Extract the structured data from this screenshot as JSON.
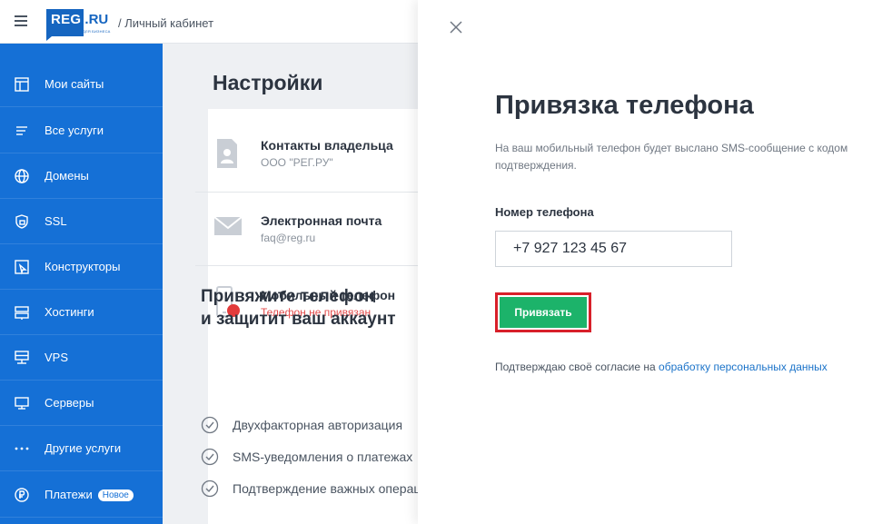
{
  "header": {
    "logo_main": "REG",
    "logo_ru": ".RU",
    "logo_sub": "ДЛЯ БИЗНЕСА",
    "breadcrumb": "/ Личный кабинет"
  },
  "sidebar": {
    "items": [
      {
        "label": "Мои сайты",
        "icon": "sites-icon"
      },
      {
        "label": "Все услуги",
        "icon": "list-icon"
      },
      {
        "label": "Домены",
        "icon": "globe-icon"
      },
      {
        "label": "SSL",
        "icon": "ssl-lock-icon"
      },
      {
        "label": "Конструкторы",
        "icon": "builder-icon"
      },
      {
        "label": "Хостинги",
        "icon": "hosting-icon"
      },
      {
        "label": "VPS",
        "icon": "vps-icon"
      },
      {
        "label": "Серверы",
        "icon": "server-icon"
      },
      {
        "label": "Другие услуги",
        "icon": "more-dots-icon"
      },
      {
        "label": "Платежи",
        "icon": "ruble-icon",
        "badge": "Новое"
      }
    ]
  },
  "main": {
    "title": "Настройки",
    "rows": [
      {
        "title": "Контакты владельца",
        "sub": "ООО \"РЕГ.РУ\"",
        "icon": "contact-card-icon"
      },
      {
        "title": "Электронная почта",
        "sub": "faq@reg.ru",
        "icon": "envelope-icon"
      },
      {
        "title": "Мобильный телефон",
        "sub": "Телефон не привязан",
        "icon": "phone-icon"
      }
    ],
    "promo_line1": "Привяжите телефон",
    "promo_line2": "и защитит ваш аккаунт",
    "checks": [
      "Двухфакторная авторизация",
      "SMS-уведомления о платежах",
      "Подтверждение важных операций"
    ]
  },
  "modal": {
    "title": "Привязка телефона",
    "description": "На ваш мобильный телефон будет выслано SMS-сообщение с кодом подтверждения.",
    "phone_label": "Номер телефона",
    "phone_value": "+7 927 123 45 67",
    "submit_label": "Привязать",
    "consent_text": "Подтверждаю своё согласие на",
    "consent_link": "обработку персональных данных"
  },
  "colors": {
    "sidebar": "#1570d6",
    "accent_green": "#1cb36a",
    "highlight_red": "#d8202a",
    "link_blue": "#1b73c9",
    "error_red": "#e34c4c"
  }
}
